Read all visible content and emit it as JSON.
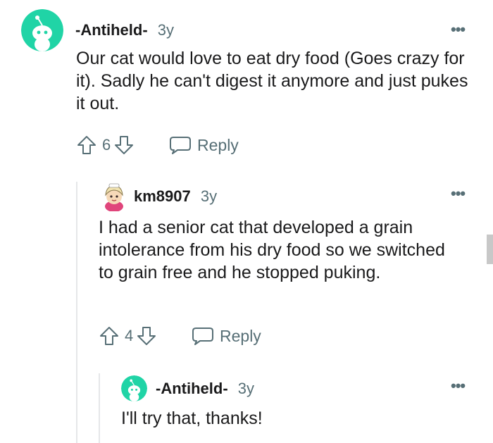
{
  "comments": [
    {
      "author": "-Antiheld-",
      "age": "3y",
      "body": "Our cat would love to eat dry food (Goes crazy for it). Sadly he can't digest it anymore and just pukes it out.",
      "score": "6",
      "reply_label": "Reply",
      "more_label": "•••",
      "avatar_color": "#20d4a6"
    },
    {
      "author": "km8907",
      "age": "3y",
      "body": "I had a senior cat that developed a grain intolerance from his dry food so we switched to grain free and he stopped puking.",
      "score": "4",
      "reply_label": "Reply",
      "more_label": "•••"
    },
    {
      "author": "-Antiheld-",
      "age": "3y",
      "body": "I'll try that, thanks!",
      "more_label": "•••",
      "avatar_color": "#20d4a6"
    }
  ]
}
